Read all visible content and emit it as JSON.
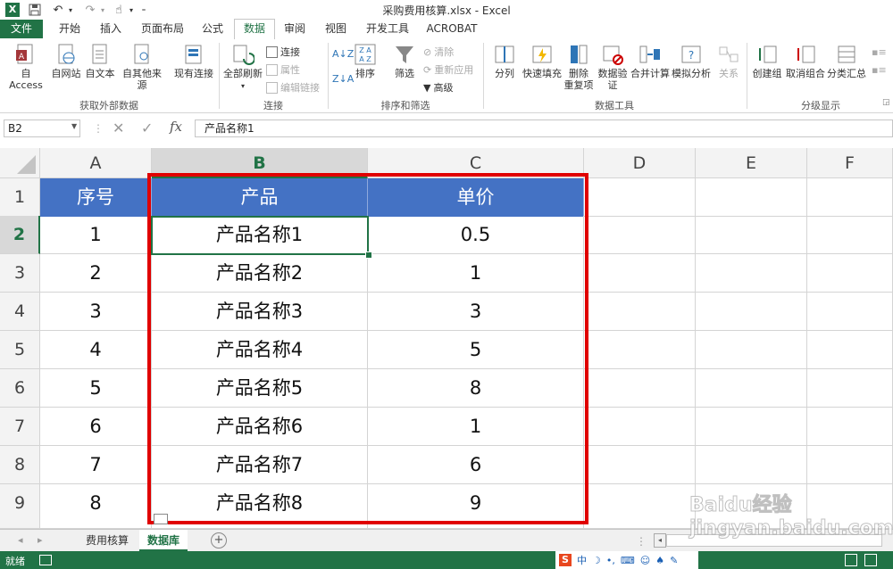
{
  "window": {
    "title": "采购费用核算.xlsx - Excel"
  },
  "tabs": [
    "文件",
    "开始",
    "插入",
    "页面布局",
    "公式",
    "数据",
    "审阅",
    "视图",
    "开发工具",
    "ACROBAT"
  ],
  "active_tab": "数据",
  "ribbon": {
    "groups": {
      "external": "获取外部数据",
      "connections": "连接",
      "sortfilter": "排序和筛选",
      "datatools": "数据工具",
      "outline": "分级显示"
    },
    "buttons": {
      "access": "自 Access",
      "web": "自网站",
      "text": "自文本",
      "other": "自其他来源",
      "existing": "现有连接",
      "refresh_all": "全部刷新",
      "connections": "连接",
      "properties": "属性",
      "edit_links": "编辑链接",
      "sort": "排序",
      "filter": "筛选",
      "clear": "清除",
      "reapply": "重新应用",
      "advanced": "高级",
      "split": "分列",
      "flash_fill": "快速填充",
      "remove_dup_1": "删除",
      "remove_dup_2": "重复项",
      "validation_1": "数据验",
      "validation_2": "证",
      "consolidate": "合并计算",
      "whatif": "模拟分析",
      "relations": "关系",
      "group": "创建组",
      "ungroup": "取消组合",
      "subtotal": "分类汇总"
    }
  },
  "formula_bar": {
    "name_box": "B2",
    "fx": "fx",
    "content": "产品名称1"
  },
  "columns": [
    "A",
    "B",
    "C",
    "D",
    "E",
    "F"
  ],
  "rows": [
    "1",
    "2",
    "3",
    "4",
    "5",
    "6",
    "7",
    "8",
    "9"
  ],
  "table": {
    "headers": [
      "序号",
      "产品",
      "单价"
    ],
    "data": [
      [
        "1",
        "产品名称1",
        "0.5"
      ],
      [
        "2",
        "产品名称2",
        "1"
      ],
      [
        "3",
        "产品名称3",
        "3"
      ],
      [
        "4",
        "产品名称4",
        "5"
      ],
      [
        "5",
        "产品名称5",
        "8"
      ],
      [
        "6",
        "产品名称6",
        "1"
      ],
      [
        "7",
        "产品名称7",
        "6"
      ],
      [
        "8",
        "产品名称8",
        "9"
      ]
    ]
  },
  "sheets": [
    "费用核算",
    "数据库"
  ],
  "active_sheet": "数据库",
  "status": {
    "ready": "就绪"
  },
  "watermark": "Baidu经验 jingyan.baidu.com",
  "colors": {
    "excel_green": "#217346",
    "header_blue": "#4472c4",
    "highlight_red": "#e00000"
  }
}
